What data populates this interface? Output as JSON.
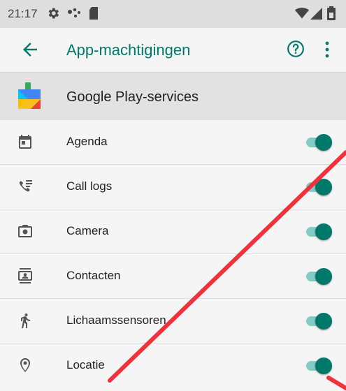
{
  "status_bar": {
    "time": "21:17"
  },
  "app_bar": {
    "title": "App-machtigingen"
  },
  "app": {
    "name": "Google Play-services"
  },
  "permissions": [
    {
      "label": "Agenda",
      "icon": "calendar-icon",
      "enabled": true
    },
    {
      "label": "Call logs",
      "icon": "call-log-icon",
      "enabled": true
    },
    {
      "label": "Camera",
      "icon": "camera-icon",
      "enabled": true
    },
    {
      "label": "Contacten",
      "icon": "contacts-icon",
      "enabled": true
    },
    {
      "label": "Lichaamssensoren",
      "icon": "body-sensors-icon",
      "enabled": true
    },
    {
      "label": "Locatie",
      "icon": "location-icon",
      "enabled": true
    }
  ],
  "colors": {
    "accent": "#00796b",
    "track": "#80cbc4",
    "annotation": "#f0323c"
  }
}
